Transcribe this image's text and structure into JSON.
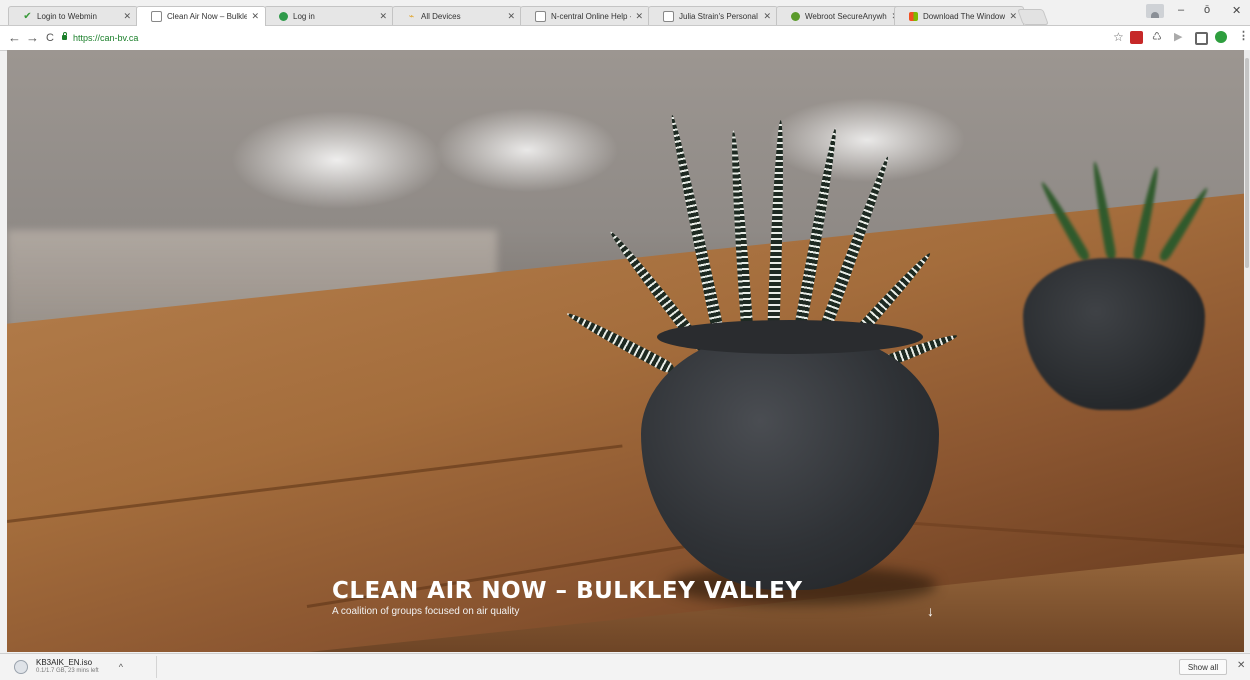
{
  "browser": {
    "tabs": [
      {
        "label": "Login to Webmin",
        "favicon": "webmin-icon",
        "color": "#3a9a3a",
        "active": false
      },
      {
        "label": "Clean Air Now – Bulkley",
        "favicon": "page-icon",
        "color": "#888888",
        "active": true
      },
      {
        "label": "Log in",
        "favicon": "login-icon",
        "color": "#2f9a4a",
        "active": false
      },
      {
        "label": "All Devices",
        "favicon": "devices-icon",
        "color": "#e0a020",
        "active": false
      },
      {
        "label": "N-central Online Help - I",
        "favicon": "page-icon",
        "color": "#888888",
        "active": false
      },
      {
        "label": "Julia Strain's Personal Bo",
        "favicon": "page-icon",
        "color": "#888888",
        "active": false
      },
      {
        "label": "Webroot SecureAnywher",
        "favicon": "webroot-icon",
        "color": "#5a9a2a",
        "active": false
      },
      {
        "label": "Download The Windows",
        "favicon": "windows-icon",
        "color": "#e04020",
        "active": false
      }
    ],
    "tab_close": "✕",
    "url": "https://can-bv.ca",
    "nav": {
      "back": "←",
      "forward": "→",
      "reload": "C"
    },
    "window_controls": {
      "minimize": "–",
      "maximize": "ō",
      "close": "✕"
    }
  },
  "page": {
    "title": "CLEAN AIR NOW – BULKLEY VALLEY",
    "subtitle": "A coalition of groups focused on air quality",
    "scroll_arrow": "↓"
  },
  "downloads": {
    "file_name": "KB3AIK_EN.iso",
    "status": "0.1/1.7 GB, 23 mins left",
    "chevron": "^",
    "show_all": "Show all",
    "close": "✕"
  }
}
